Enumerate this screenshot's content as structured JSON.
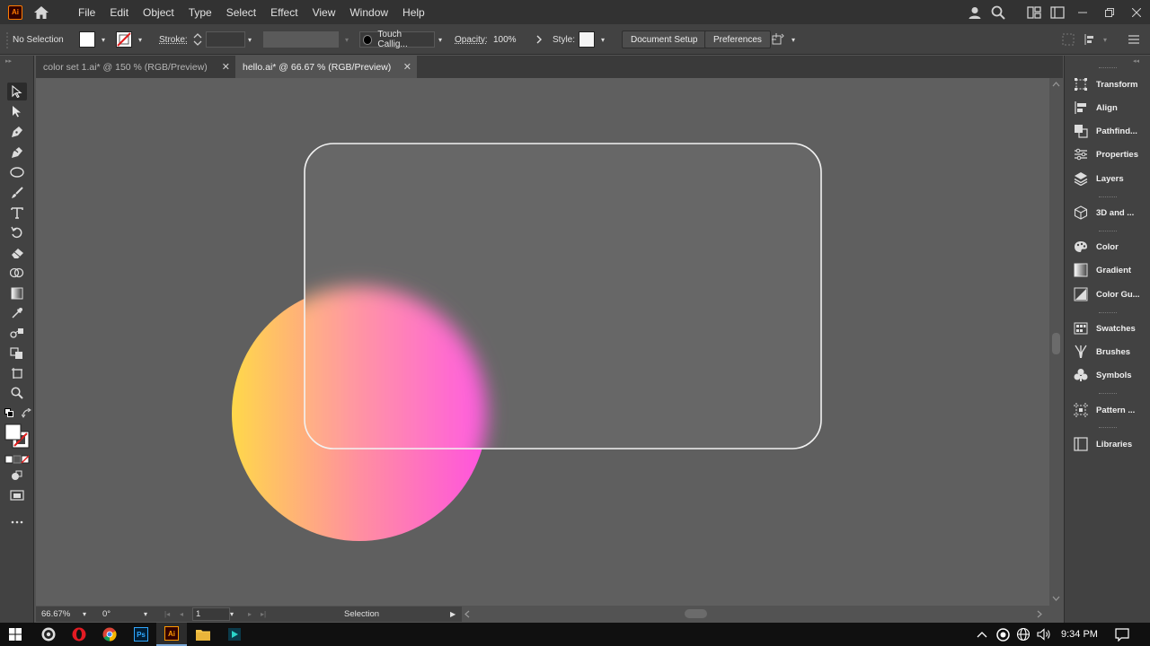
{
  "app": {
    "logo_text": "Ai"
  },
  "menu": [
    "File",
    "Edit",
    "Object",
    "Type",
    "Select",
    "Effect",
    "View",
    "Window",
    "Help"
  ],
  "control_bar": {
    "selection_label": "No Selection",
    "stroke_label": "Stroke:",
    "brush_name": "Touch Callig...",
    "opacity_label": "Opacity:",
    "opacity_value": "100%",
    "style_label": "Style:",
    "document_setup": "Document Setup",
    "preferences": "Preferences"
  },
  "tabs": [
    {
      "label": "color set 1.ai* @ 150 % (RGB/Preview)",
      "active": false
    },
    {
      "label": "hello.ai* @ 66.67 % (RGB/Preview)",
      "active": true
    }
  ],
  "tools": [
    "selection-tool",
    "direct-selection-tool",
    "pen-tool",
    "curvature-tool",
    "ellipse-tool",
    "paintbrush-tool",
    "type-tool",
    "rotate-tool",
    "eraser-tool",
    "shape-builder-tool",
    "gradient-tool",
    "eyedropper-tool",
    "blend-tool",
    "live-paint-tool",
    "artboard-tool",
    "zoom-tool"
  ],
  "status_bar": {
    "zoom": "66.67%",
    "rotation": "0°",
    "artboard": "1",
    "mode": "Selection"
  },
  "panels": [
    {
      "label": "Transform",
      "icon": "transform-icon"
    },
    {
      "label": "Align",
      "icon": "align-icon"
    },
    {
      "label": "Pathfind...",
      "icon": "pathfinder-icon"
    },
    {
      "label": "Properties",
      "icon": "properties-icon"
    },
    {
      "label": "Layers",
      "icon": "layers-icon"
    },
    {
      "label": "3D and ...",
      "icon": "3d-icon"
    },
    {
      "label": "Color",
      "icon": "color-icon"
    },
    {
      "label": "Gradient",
      "icon": "gradient-icon"
    },
    {
      "label": "Color Gu...",
      "icon": "color-guide-icon"
    },
    {
      "label": "Swatches",
      "icon": "swatches-icon"
    },
    {
      "label": "Brushes",
      "icon": "brushes-icon"
    },
    {
      "label": "Symbols",
      "icon": "symbols-icon"
    },
    {
      "label": "Pattern ...",
      "icon": "pattern-icon"
    },
    {
      "label": "Libraries",
      "icon": "libraries-icon"
    }
  ],
  "taskbar": {
    "apps": [
      "obs-icon",
      "opera-icon",
      "chrome-icon",
      "photoshop-icon",
      "illustrator-icon",
      "file-explorer-icon",
      "media-player-icon"
    ],
    "photoshop_text": "Ps",
    "illustrator_text": "Ai",
    "time": "9:34 PM"
  },
  "colors": {
    "gradient_start": "#ffd84a",
    "gradient_mid": "#ff8fa0",
    "gradient_end": "#ff52e0",
    "canvas": "#5f5f5f",
    "glass_border": "#f2f2f2"
  }
}
